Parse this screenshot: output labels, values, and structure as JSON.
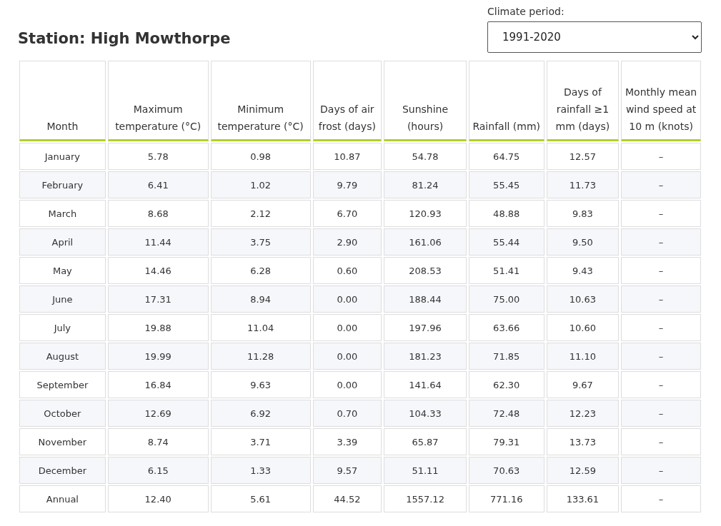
{
  "station_title": "Station: High Mowthorpe",
  "climate_period": {
    "label": "Climate period:",
    "value": "1991-2020"
  },
  "table": {
    "columns": [
      "Month",
      "Maximum temperature (°C)",
      "Minimum temperature (°C)",
      "Days of air frost (days)",
      "Sunshine (hours)",
      "Rainfall (mm)",
      "Days of rainfall ≥1 mm (days)",
      "Monthly mean wind speed at 10 m (knots)"
    ],
    "rows": [
      [
        "January",
        "5.78",
        "0.98",
        "10.87",
        "54.78",
        "64.75",
        "12.57",
        "–"
      ],
      [
        "February",
        "6.41",
        "1.02",
        "9.79",
        "81.24",
        "55.45",
        "11.73",
        "–"
      ],
      [
        "March",
        "8.68",
        "2.12",
        "6.70",
        "120.93",
        "48.88",
        "9.83",
        "–"
      ],
      [
        "April",
        "11.44",
        "3.75",
        "2.90",
        "161.06",
        "55.44",
        "9.50",
        "–"
      ],
      [
        "May",
        "14.46",
        "6.28",
        "0.60",
        "208.53",
        "51.41",
        "9.43",
        "–"
      ],
      [
        "June",
        "17.31",
        "8.94",
        "0.00",
        "188.44",
        "75.00",
        "10.63",
        "–"
      ],
      [
        "July",
        "19.88",
        "11.04",
        "0.00",
        "197.96",
        "63.66",
        "10.60",
        "–"
      ],
      [
        "August",
        "19.99",
        "11.28",
        "0.00",
        "181.23",
        "71.85",
        "11.10",
        "–"
      ],
      [
        "September",
        "16.84",
        "9.63",
        "0.00",
        "141.64",
        "62.30",
        "9.67",
        "–"
      ],
      [
        "October",
        "12.69",
        "6.92",
        "0.70",
        "104.33",
        "72.48",
        "12.23",
        "–"
      ],
      [
        "November",
        "8.74",
        "3.71",
        "3.39",
        "65.87",
        "79.31",
        "13.73",
        "–"
      ],
      [
        "December",
        "6.15",
        "1.33",
        "9.57",
        "51.11",
        "70.63",
        "12.59",
        "–"
      ],
      [
        "Annual",
        "12.40",
        "5.61",
        "44.52",
        "1557.12",
        "771.16",
        "133.61",
        "–"
      ]
    ]
  }
}
